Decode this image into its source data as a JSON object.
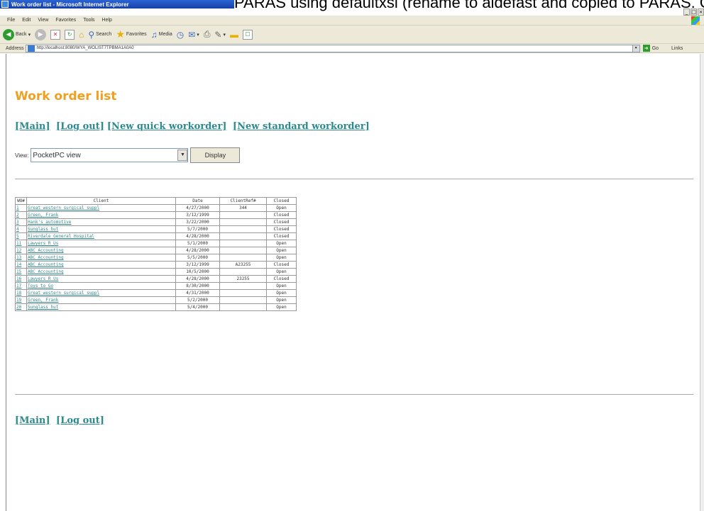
{
  "caption": "PARAS using defaultxsl (rename to aldefast and copied to PARAS. OE",
  "window": {
    "title": "Work order list - Microsoft Internet Explorer",
    "controls": [
      "_",
      "□",
      "×"
    ]
  },
  "menubar": [
    "File",
    "Edit",
    "View",
    "Favorites",
    "Tools",
    "Help"
  ],
  "toolbar": {
    "back_label": "Back",
    "search_label": "Search",
    "favorites_label": "Favorites",
    "media_label": "Media"
  },
  "address": {
    "label": "Address",
    "url": "http://localhost:8080/WYA_WOLIST7TPBMA1A0A0",
    "go_label": "Go",
    "links_label": "Links"
  },
  "page": {
    "title": "Work order list",
    "nav": {
      "main": "[Main]",
      "logout": "[Log out]",
      "new_quick": "[New quick workorder]",
      "new_standard": "[New standard workorder]"
    },
    "view_label": "View:",
    "view_value": "PocketPC view",
    "display_button": "Display",
    "table": {
      "headers": [
        "WO#",
        "Client",
        "Date",
        "ClientRef#",
        "Closed"
      ],
      "rows": [
        [
          "1 ",
          "Great western surgical suppl",
          "4/27/2000",
          "344",
          "Open"
        ],
        [
          "2 ",
          "Green, Frank",
          "3/12/1999",
          "",
          "Closed"
        ],
        [
          "3 ",
          "Hank's automotive",
          "3/22/2000",
          "",
          "Closed"
        ],
        [
          "4 ",
          "Sunglass hut",
          "5/7/2000",
          "",
          "Closed"
        ],
        [
          "5 ",
          "Riverdale General Hospital",
          "4/28/2000",
          "",
          "Closed"
        ],
        [
          "11",
          "Lawyers R Us",
          "5/1/2000",
          "",
          "Open"
        ],
        [
          "12",
          "ABC Accounting",
          "4/28/2000",
          "",
          "Open"
        ],
        [
          "13",
          "ABC Accounting",
          "5/5/2000",
          "",
          "Open"
        ],
        [
          "14",
          "ABC Accounting",
          "3/12/1999",
          "A23255",
          "Closed"
        ],
        [
          "15",
          "ABC Accounting",
          "10/5/2000",
          "",
          "Open"
        ],
        [
          "16",
          "Lawyers R Us",
          "4/28/2000",
          "23255",
          "Closed"
        ],
        [
          "17",
          "Toys to Go",
          "8/30/2000",
          "",
          "Open"
        ],
        [
          "18",
          "Great western surgical suppl",
          "4/31/2000",
          "",
          "Open"
        ],
        [
          "19",
          "Green, Frank",
          "5/2/2000",
          "",
          "Open"
        ],
        [
          "20",
          "Sunglass hut",
          "5/4/2000",
          "",
          "Open"
        ]
      ]
    },
    "bottom_nav": {
      "main": "[Main]",
      "logout": "[Log out]"
    }
  },
  "colors": {
    "title": "#f0a020",
    "link": "#2a8a8f",
    "titlebar": "#1f4fc0"
  }
}
